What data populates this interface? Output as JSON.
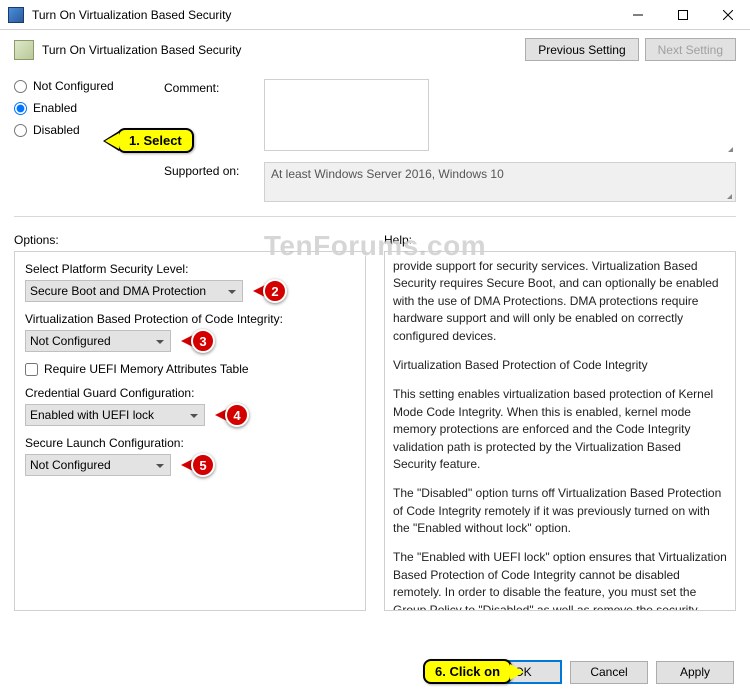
{
  "titlebar": {
    "text": "Turn On Virtualization Based Security"
  },
  "header": {
    "title": "Turn On Virtualization Based Security",
    "prev": "Previous Setting",
    "next": "Next Setting"
  },
  "radios": {
    "not_configured": "Not Configured",
    "enabled": "Enabled",
    "disabled": "Disabled"
  },
  "labels": {
    "comment": "Comment:",
    "supported_on": "Supported on:",
    "options": "Options:",
    "help": "Help:"
  },
  "supported_text": "At least Windows Server 2016, Windows 10",
  "options": {
    "platform_label": "Select Platform Security Level:",
    "platform_value": "Secure Boot and DMA Protection",
    "vbp_label": "Virtualization Based Protection of Code Integrity:",
    "vbp_value": "Not Configured",
    "uefi_check": "Require UEFI Memory Attributes Table",
    "credguard_label": "Credential Guard Configuration:",
    "credguard_value": "Enabled with UEFI lock",
    "securelaunch_label": "Secure Launch Configuration:",
    "securelaunch_value": "Not Configured"
  },
  "help_text": {
    "p1": "provide support for security services. Virtualization Based Security requires Secure Boot, and can optionally be enabled with the use of DMA Protections. DMA protections require hardware support and will only be enabled on correctly configured devices.",
    "p2": "Virtualization Based Protection of Code Integrity",
    "p3": "This setting enables virtualization based protection of Kernel Mode Code Integrity. When this is enabled, kernel mode memory protections are enforced and the Code Integrity validation path is protected by the Virtualization Based Security feature.",
    "p4": "The \"Disabled\" option turns off Virtualization Based Protection of Code Integrity remotely if it was previously turned on with the \"Enabled without lock\" option.",
    "p5": "The \"Enabled with UEFI lock\" option ensures that Virtualization Based Protection of Code Integrity cannot be disabled remotely. In order to disable the feature, you must set the Group Policy to \"Disabled\" as well as remove the security functionality from each"
  },
  "footer": {
    "ok": "OK",
    "cancel": "Cancel",
    "apply": "Apply"
  },
  "annotations": {
    "callout1": "1. Select",
    "callout6": "6. Click on",
    "n2": "2",
    "n3": "3",
    "n4": "4",
    "n5": "5"
  },
  "watermark": "TenForums.com"
}
